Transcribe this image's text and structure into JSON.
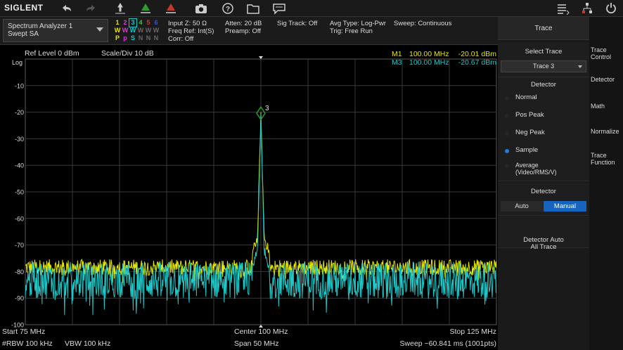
{
  "toolbar": {
    "logo": "SIGLENT",
    "icons": [
      "undo-icon",
      "redo-icon",
      "marker-to-peak-icon",
      "marker-icon",
      "limit-icon",
      "screenshot-icon",
      "help-icon",
      "file-icon",
      "message-icon",
      "menu-list-icon",
      "network-icon",
      "power-icon"
    ]
  },
  "mode": {
    "line1": "Spectrum Analyzer 1",
    "line2": "Swept SA"
  },
  "traces": {
    "numbers": [
      "1",
      "2",
      "3",
      "4",
      "5",
      "6"
    ],
    "types": [
      "W",
      "W",
      "W",
      "W",
      "W",
      "W"
    ],
    "dets": [
      "P",
      "p",
      "S",
      "N",
      "N",
      "N"
    ],
    "colors": [
      "#e8e800",
      "#d040d0",
      "#00d0d0",
      "#40c040",
      "#e03030",
      "#3050e0"
    ]
  },
  "status": {
    "input_z": "Input Z: 50 Ω",
    "freq_ref": "Freq Ref: Int(S)",
    "corr": "Corr: Off",
    "atten": "Atten: 20 dB",
    "preamp": "Preamp: Off",
    "sig_track": "Sig Track: Off",
    "avg_type": "Avg Type: Log-Pwr",
    "trig": "Trig: Free Run",
    "sweep_mode": "Sweep: Continuous"
  },
  "plot": {
    "ref_level": "Ref Level  0 dBm",
    "scale": "Scale/Div  10 dB",
    "log": "Log",
    "y_ticks": [
      "-10",
      "-20",
      "-30",
      "-40",
      "-50",
      "-60",
      "-70",
      "-80",
      "-90",
      "-100"
    ],
    "marker_m1": {
      "name": "M1",
      "freq": "100.00 MHz",
      "level": "-20.01 dBm"
    },
    "marker_m3": {
      "name": "M3",
      "freq": "100.00 MHz",
      "level": "-20.67 dBm"
    },
    "marker_label": "3",
    "start": "Start  75 MHz",
    "center": "Center  100 MHz",
    "stop": "Stop  125 MHz",
    "rbw": "#RBW  100 kHz",
    "vbw": "VBW  100 kHz",
    "span": "Span  50 MHz",
    "sweep": "Sweep  ~60.841 ms (1001pts)"
  },
  "colors": {
    "trace1": "#e6e600",
    "trace3": "#1ec8c8",
    "marker": "#2e9b2e",
    "accent": "#1565c0"
  },
  "panel": {
    "title": "Trace",
    "select_trace_label": "Select Trace",
    "select_trace_value": "Trace 3",
    "detector_label": "Detector",
    "detectors": [
      "Normal",
      "Pos Peak",
      "Neg Peak",
      "Sample",
      "Average\n(Video/RMS/V)"
    ],
    "selected_detector": "Sample",
    "detector2_label": "Detector",
    "auto": "Auto",
    "manual": "Manual",
    "detector_auto_all": "Detector Auto\nAll Trace"
  },
  "tabs": [
    "Trace\nControl",
    "Detector",
    "Math",
    "Normalize",
    "Trace\nFunction"
  ],
  "chart_data": {
    "type": "line",
    "title": "",
    "xlabel": "",
    "ylabel": "",
    "x_start_mhz": 75,
    "x_stop_mhz": 125,
    "xlim": [
      75,
      125
    ],
    "ylim": [
      -100,
      0
    ],
    "grid": true,
    "series": [
      {
        "color": "#e6e600",
        "points": [
          [
            75,
            -78
          ],
          [
            99,
            -78
          ],
          [
            99.8,
            -67
          ],
          [
            100,
            -20.01
          ],
          [
            100.2,
            -67
          ],
          [
            101,
            -78
          ],
          [
            125,
            -78
          ]
        ]
      },
      {
        "color": "#1ec8c8",
        "points": [
          [
            75,
            -84
          ],
          [
            99,
            -84
          ],
          [
            99.8,
            -72
          ],
          [
            100,
            -20.67
          ],
          [
            100.2,
            -72
          ],
          [
            101,
            -84
          ],
          [
            125,
            -84
          ]
        ]
      }
    ]
  }
}
